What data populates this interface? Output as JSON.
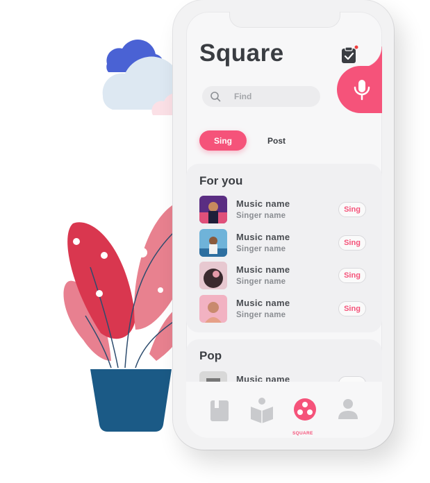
{
  "header": {
    "title": "Square"
  },
  "search": {
    "placeholder": "Find"
  },
  "tabs": [
    {
      "label": "Sing"
    },
    {
      "label": "Post"
    }
  ],
  "sections": [
    {
      "title": "For you",
      "items": [
        {
          "song": "Music name",
          "singer": "Singer name",
          "action": "Sing"
        },
        {
          "song": "Music name",
          "singer": "Singer name",
          "action": "Sing"
        },
        {
          "song": "Music name",
          "singer": "Singer name",
          "action": "Sing"
        },
        {
          "song": "Music name",
          "singer": "Singer name",
          "action": "Sing"
        }
      ]
    },
    {
      "title": "Pop",
      "items": [
        {
          "song": "Music name"
        }
      ]
    }
  ],
  "tabbar": {
    "items": [
      {
        "icon": "book-icon"
      },
      {
        "icon": "reading-icon"
      },
      {
        "icon": "square-icon",
        "label": "SQUARE",
        "active": true
      },
      {
        "icon": "profile-icon"
      }
    ]
  },
  "colors": {
    "accent": "#f5537a",
    "text": "#3a3d42",
    "plant_pot": "#1b5a86"
  }
}
